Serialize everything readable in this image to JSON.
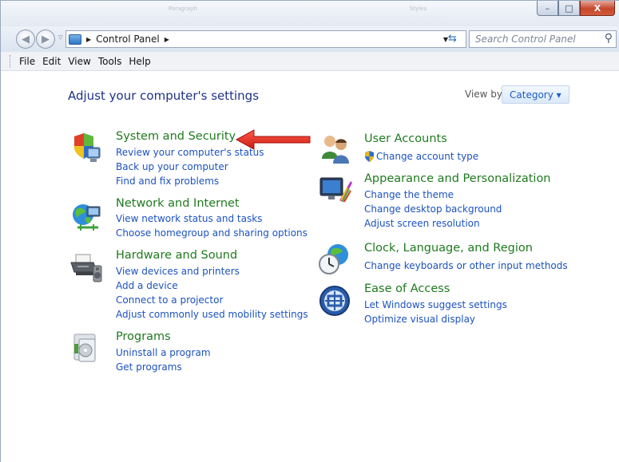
{
  "window": {
    "ghost_texts": [
      "Paragraph",
      "Styles"
    ],
    "caption": {
      "minimize": "–",
      "maximize": "□",
      "close": "X"
    }
  },
  "nav": {
    "back": "◀",
    "forward": "▶",
    "breadcrumb": "Control Panel",
    "search_placeholder": "Search Control Panel"
  },
  "menu": [
    "File",
    "Edit",
    "View",
    "Tools",
    "Help"
  ],
  "main": {
    "heading": "Adjust your computer's settings",
    "view_by_label": "View by:",
    "view_by_value": "Category"
  },
  "categories_left": [
    {
      "title": "System and Security",
      "icon": "shield-pc-icon",
      "links": [
        "Review your computer's status",
        "Back up your computer",
        "Find and fix problems"
      ]
    },
    {
      "title": "Network and Internet",
      "icon": "globe-network-icon",
      "links": [
        "View network status and tasks",
        "Choose homegroup and sharing options"
      ]
    },
    {
      "title": "Hardware and Sound",
      "icon": "printer-speaker-icon",
      "links": [
        "View devices and printers",
        "Add a device",
        "Connect to a projector",
        "Adjust commonly used mobility settings"
      ]
    },
    {
      "title": "Programs",
      "icon": "programs-icon",
      "links": [
        "Uninstall a program",
        "Get programs"
      ]
    }
  ],
  "categories_right": [
    {
      "title": "User Accounts",
      "icon": "users-icon",
      "links": [
        "Change account type"
      ]
    },
    {
      "title": "Appearance and Personalization",
      "icon": "monitor-brush-icon",
      "links": [
        "Change the theme",
        "Change desktop background",
        "Adjust screen resolution"
      ]
    },
    {
      "title": "Clock, Language, and Region",
      "icon": "clock-globe-icon",
      "links": [
        "Change keyboards or other input methods"
      ]
    },
    {
      "title": "Ease of Access",
      "icon": "ease-of-access-icon",
      "links": [
        "Let Windows suggest settings",
        "Optimize visual display"
      ]
    }
  ],
  "colors": {
    "category_title": "#1f7a1f",
    "link": "#1c52c0",
    "heading": "#1e3287",
    "annotation_arrow": "#e0241b"
  }
}
